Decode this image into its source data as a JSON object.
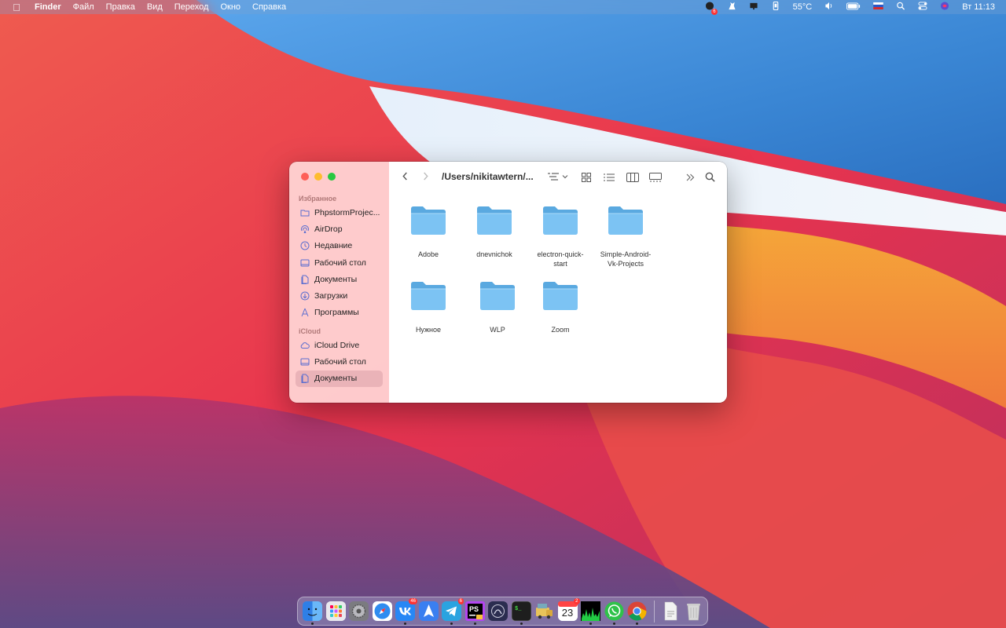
{
  "menubar": {
    "app": "Finder",
    "items": [
      "Файл",
      "Правка",
      "Вид",
      "Переход",
      "Окно",
      "Справка"
    ],
    "tray": {
      "temperature": "55°C",
      "clock": "Вт 11:13",
      "notification_badge": "6"
    }
  },
  "finder": {
    "path": "/Users/nikitawtern/...",
    "sidebar": {
      "favorites_title": "Избранное",
      "favorites": [
        {
          "label": "PhpstormProjec...",
          "icon": "folder-icon"
        },
        {
          "label": "AirDrop",
          "icon": "airdrop-icon"
        },
        {
          "label": "Недавние",
          "icon": "clock-icon"
        },
        {
          "label": "Рабочий стол",
          "icon": "desktop-icon"
        },
        {
          "label": "Документы",
          "icon": "document-icon"
        },
        {
          "label": "Загрузки",
          "icon": "download-icon"
        },
        {
          "label": "Программы",
          "icon": "apps-icon"
        }
      ],
      "icloud_title": "iCloud",
      "icloud": [
        {
          "label": "iCloud Drive",
          "icon": "cloud-icon"
        },
        {
          "label": "Рабочий стол",
          "icon": "desktop-icon"
        },
        {
          "label": "Документы",
          "icon": "document-icon",
          "selected": true
        }
      ]
    },
    "folders": [
      {
        "name": "Adobe"
      },
      {
        "name": "dnevnichok"
      },
      {
        "name": "electron-quick-start"
      },
      {
        "name": "Simple-Android-Vk-Projects"
      },
      {
        "name": "Нужное"
      },
      {
        "name": "WLP"
      },
      {
        "name": "Zoom"
      }
    ]
  },
  "dock": {
    "apps": [
      {
        "name": "Finder",
        "color": "#3d8ef0",
        "running": true
      },
      {
        "name": "Launchpad",
        "color": "#e8e8ea"
      },
      {
        "name": "System Preferences",
        "color": "#8a8a8f"
      },
      {
        "name": "Safari",
        "color": "#2f8cf0"
      },
      {
        "name": "VK",
        "color": "#2787f5",
        "badge": "46",
        "running": true
      },
      {
        "name": "Maps",
        "color": "#3e7ee8"
      },
      {
        "name": "Telegram",
        "color": "#2aa3e0",
        "badge": "6",
        "running": true
      },
      {
        "name": "PhpStorm EAP",
        "color": "#111111",
        "running": true
      },
      {
        "name": "Alfred",
        "color": "#2b2d50"
      },
      {
        "name": "Terminal",
        "color": "#1e1e1e",
        "running": true
      },
      {
        "name": "Transmit",
        "color": "#e8c35a"
      },
      {
        "name": "Calendar",
        "color": "#ffffff",
        "badge": "2",
        "day": "23"
      },
      {
        "name": "Activity Monitor",
        "color": "#101010",
        "running": true
      },
      {
        "name": "WhatsApp",
        "color": "#2fc24a",
        "running": true
      },
      {
        "name": "Chrome",
        "color": "#ffffff",
        "running": true
      }
    ],
    "right": [
      {
        "name": "Document",
        "color": "#f2f2f2"
      },
      {
        "name": "Trash",
        "color": "#d7d7d7"
      }
    ]
  }
}
